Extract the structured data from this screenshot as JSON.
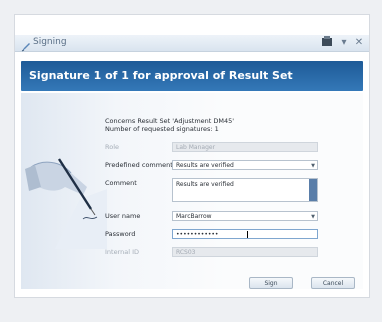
{
  "window": {
    "title": "Signing",
    "minimize": "▾",
    "close": "✕"
  },
  "banner": {
    "heading": "Signature 1 of 1 for approval of Result Set"
  },
  "info": {
    "line1": "Concerns Result Set 'Adjustment DM45'",
    "line2": "Number of requested signatures: 1"
  },
  "form": {
    "role": {
      "label": "Role",
      "value": "Lab Manager"
    },
    "predefined_comment": {
      "label": "Predefined comment",
      "value": "Results are verified"
    },
    "comment": {
      "label": "Comment",
      "value": "Results are verified"
    },
    "user_name": {
      "label": "User name",
      "value": "MarcBarrow"
    },
    "password": {
      "label": "Password",
      "value": "••••••••••••"
    },
    "internal_id": {
      "label": "Internal ID",
      "value": "RCS03"
    }
  },
  "buttons": {
    "sign": "Sign",
    "cancel": "Cancel"
  },
  "colors": {
    "banner": "#2a6aa9",
    "accent": "#5a7ea9"
  }
}
